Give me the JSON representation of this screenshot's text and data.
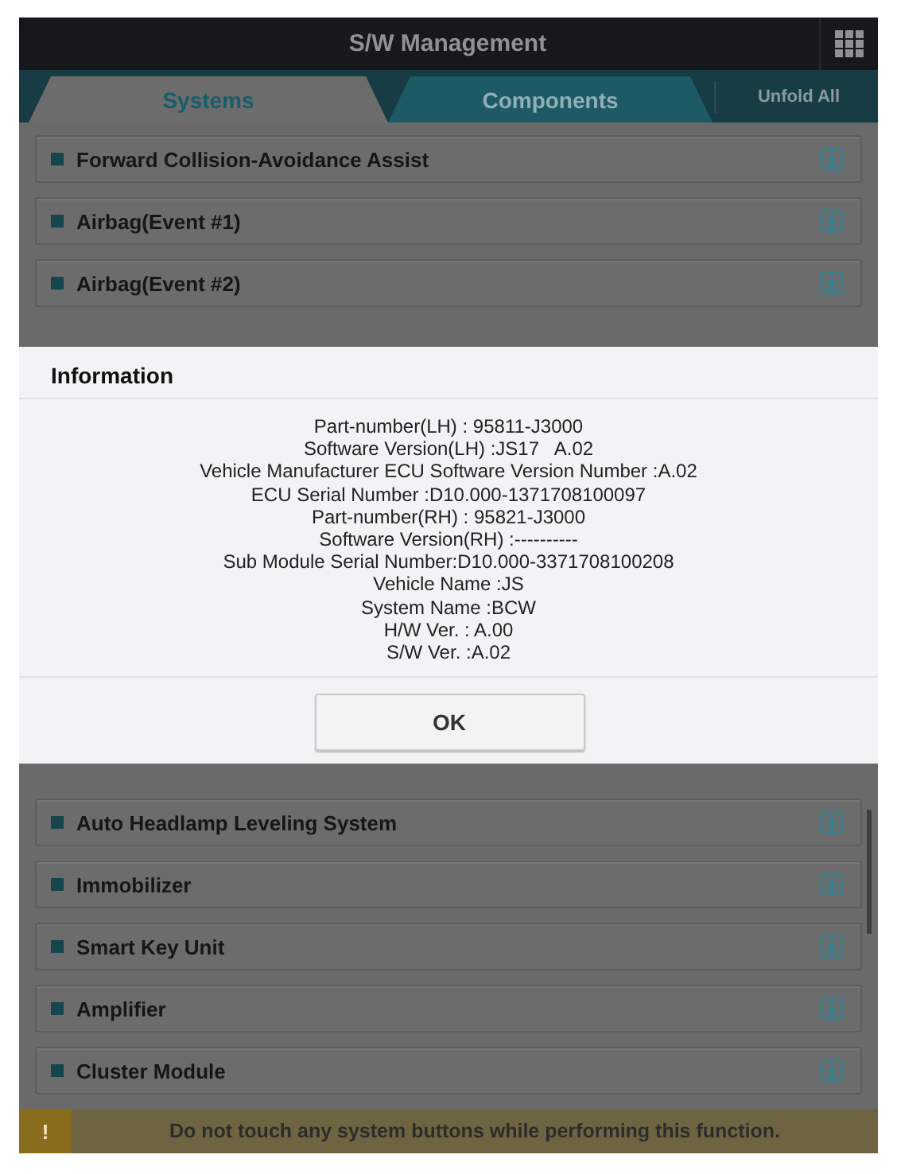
{
  "header": {
    "title": "S/W Management"
  },
  "tabs": [
    {
      "label": "Systems",
      "selected": true
    },
    {
      "label": "Components",
      "selected": false
    }
  ],
  "unfold_all": "Unfold All",
  "systems_above": [
    "Forward Collision-Avoidance Assist",
    "Airbag(Event #1)",
    "Airbag(Event #2)"
  ],
  "systems_below": [
    "Auto Headlamp Leveling System",
    "Immobilizer",
    "Smart Key Unit",
    "Amplifier",
    "Cluster Module"
  ],
  "dialog": {
    "title": "Information",
    "lines": [
      "Part-number(LH) : 95811-J3000",
      "Software Version(LH) :JS17   A.02",
      "Vehicle Manufacturer ECU Software Version Number :A.02",
      "ECU Serial Number :D10.000-1371708100097",
      "Part-number(RH) : 95821-J3000",
      "Software Version(RH) :----------",
      "Sub Module Serial Number:D10.000-3371708100208",
      "Vehicle Name :JS",
      "System Name :BCW",
      "H/W Ver. : A.00",
      "S/W Ver. :A.02"
    ],
    "button": "OK"
  },
  "warning": {
    "icon": "!",
    "text": "Do not touch any system buttons while performing this function."
  }
}
